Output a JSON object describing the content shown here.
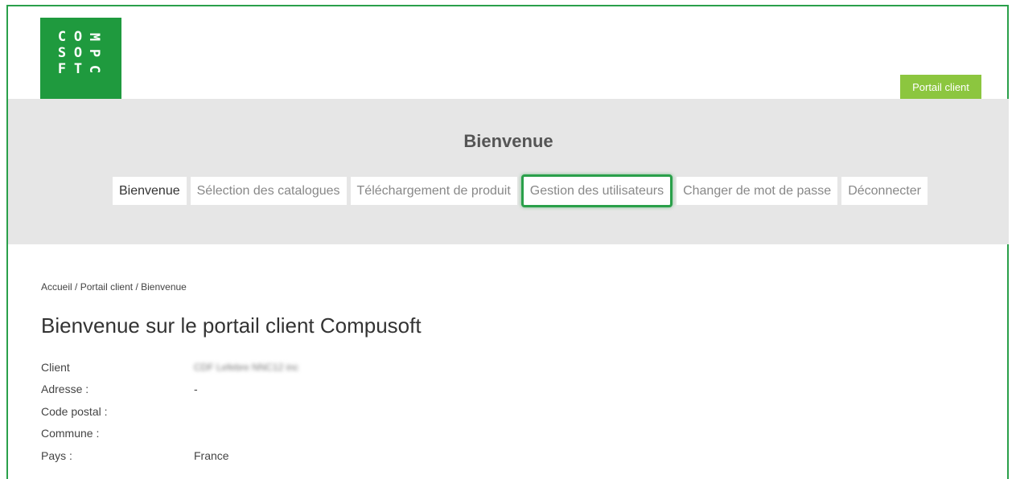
{
  "brand": {
    "logo_letters": [
      "C",
      "O",
      "M",
      "S",
      "O",
      "P",
      "F",
      "T",
      "C"
    ],
    "brand_green": "#1f9a3e",
    "accent_green": "#8cc63f"
  },
  "header": {
    "portal_button": "Portail client"
  },
  "band": {
    "title": "Bienvenue"
  },
  "nav": {
    "items": [
      {
        "label": "Bienvenue"
      },
      {
        "label": "Sélection des catalogues"
      },
      {
        "label": "Téléchargement de produit"
      },
      {
        "label": "Gestion des utilisateurs"
      },
      {
        "label": "Changer de mot de passe"
      },
      {
        "label": "Déconnecter"
      }
    ]
  },
  "breadcrumb": {
    "items": [
      "Accueil",
      "Portail client",
      "Bienvenue"
    ],
    "separator": "/"
  },
  "main": {
    "title": "Bienvenue sur le portail client Compusoft",
    "fields": [
      {
        "label": "Client",
        "value": "CDF Lefebre NNC12 inc"
      },
      {
        "label": "Adresse :",
        "value": "-"
      },
      {
        "label": "Code postal :",
        "value": ""
      },
      {
        "label": "Commune :",
        "value": ""
      },
      {
        "label": "Pays :",
        "value": "France"
      }
    ]
  }
}
